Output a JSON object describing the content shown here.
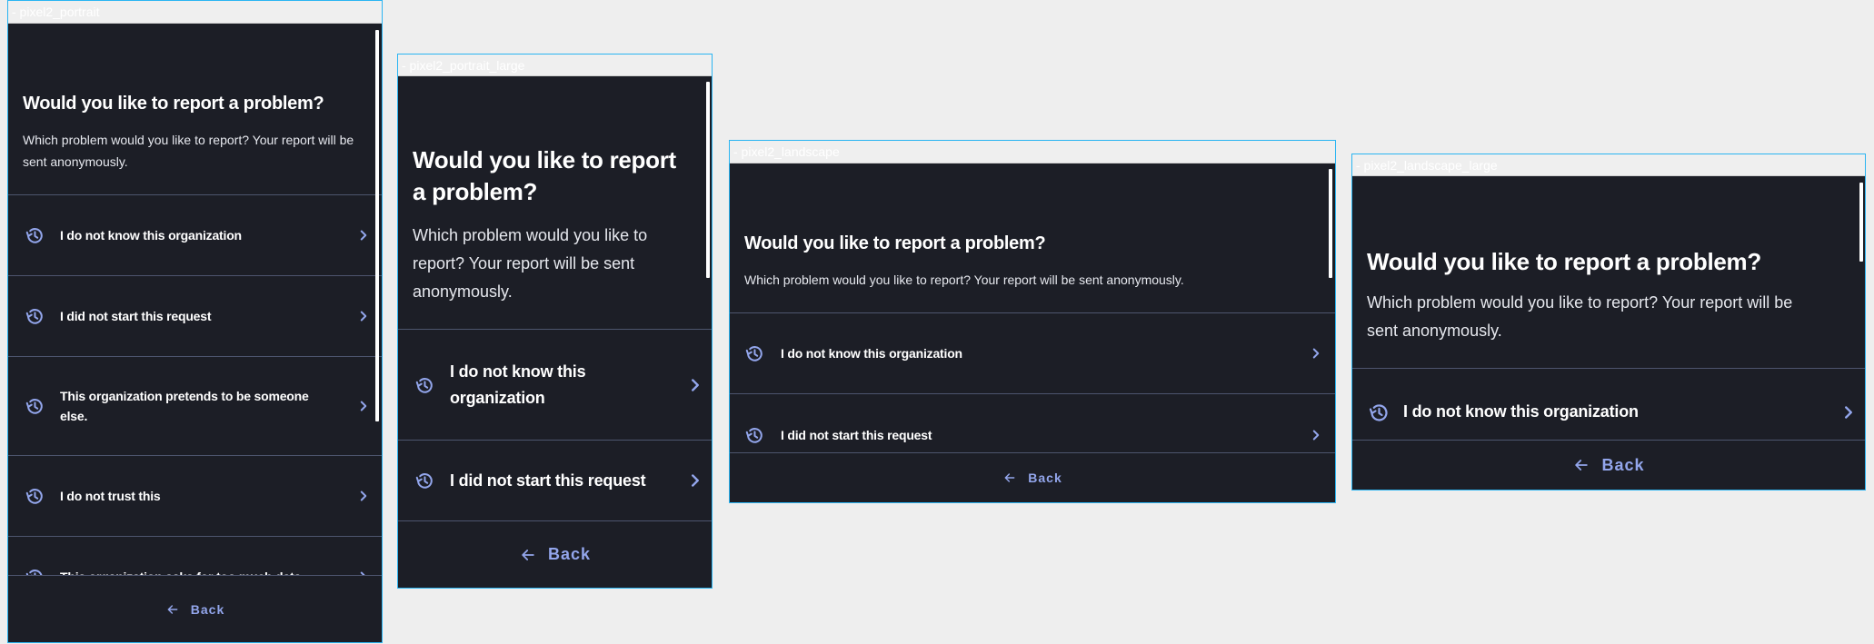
{
  "colors": {
    "background": "#1c1e26",
    "accent": "#93a6ec",
    "divider": "#4d556e",
    "frame_border": "#2bb5f2"
  },
  "icons": {
    "item": "history-icon",
    "chevron": "chevron-right-icon",
    "back": "arrow-left-icon"
  },
  "frames": [
    {
      "label": "- pixel2_portrait",
      "title": "Would you like to report a problem?",
      "subtitle": "Which problem would you like to report? Your report will be sent anonymously.",
      "items": [
        "I do not know this organization",
        "I did not start this request",
        "This organization pretends to be someone else.",
        "I do not trust this",
        "This organization asks for too much data"
      ],
      "back": "Back"
    },
    {
      "label": "- pixel2_portrait_large",
      "title": "Would you like to report a problem?",
      "subtitle": "Which problem would you like to report? Your report will be sent anonymously.",
      "items": [
        "I do not know this organization",
        "I did not start this request"
      ],
      "back": "Back"
    },
    {
      "label": "- pixel2_landscape",
      "title": "Would you like to report a problem?",
      "subtitle": "Which problem would you like to report? Your report will be sent anonymously.",
      "items": [
        "I do not know this organization",
        "I did not start this request"
      ],
      "back": "Back"
    },
    {
      "label": "- pixel2_landscape_large",
      "title": "Would you like to report a problem?",
      "subtitle": "Which problem would you like to report? Your report will be sent anonymously.",
      "items": [
        "I do not know this organization"
      ],
      "back": "Back"
    }
  ]
}
